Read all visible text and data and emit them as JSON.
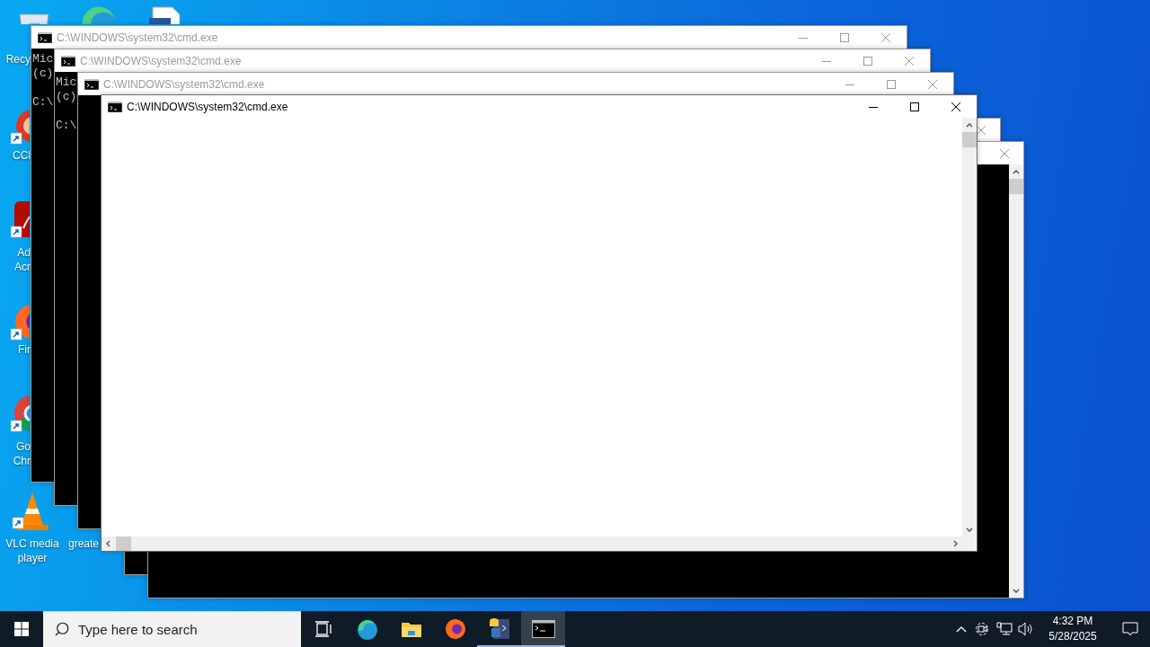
{
  "desktop_icons": [
    {
      "kind": "recycle-bin",
      "label_lines": [
        "Recy"
      ]
    },
    {
      "kind": "edge"
    },
    {
      "kind": "document"
    },
    {
      "kind": "ccleaner",
      "label_lines": [
        "CCl"
      ]
    },
    {
      "kind": "acrobat",
      "label_lines": [
        "Ad",
        "Acr"
      ]
    },
    {
      "kind": "firefox",
      "label_lines": [
        "Fir"
      ]
    },
    {
      "kind": "chrome",
      "label_lines": [
        "Go",
        "Chr"
      ]
    },
    {
      "kind": "vlc",
      "label_lines": [
        "VLC media",
        "player"
      ]
    },
    {
      "kind": "hidden",
      "label_lines": [
        "greate"
      ]
    }
  ],
  "windows": [
    {
      "title": "C:\\WINDOWS\\system32\\cmd.exe",
      "active": false,
      "kind": "console",
      "console_blocks": [
        [
          "Mic",
          "(c)"
        ],
        [
          "C:\\"
        ]
      ],
      "controls": [
        {
          "kind": "minimize"
        },
        {
          "kind": "maximize"
        },
        {
          "kind": "close"
        }
      ]
    },
    {
      "title": "C:\\WINDOWS\\system32\\cmd.exe",
      "active": false,
      "kind": "console",
      "console_blocks": [
        [
          "Mic",
          "(c)"
        ],
        [
          "C:\\"
        ]
      ],
      "controls": [
        {
          "kind": "minimize"
        },
        {
          "kind": "maximize"
        },
        {
          "kind": "close"
        }
      ]
    },
    {
      "title": "C:\\WINDOWS\\system32\\cmd.exe",
      "active": false,
      "kind": "console",
      "controls": [
        {
          "kind": "minimize"
        },
        {
          "kind": "maximize"
        },
        {
          "kind": "close"
        }
      ]
    },
    {
      "title": "C:\\WINDOWS\\system32\\cmd.exe",
      "active": true,
      "kind": "blank",
      "controls": [
        {
          "kind": "minimize"
        },
        {
          "kind": "maximize"
        },
        {
          "kind": "close"
        }
      ],
      "vertical_scrollbar": true,
      "horizontal_scrollbar": true
    },
    {
      "active": false,
      "kind": "console",
      "controls": [
        {
          "kind": "close"
        }
      ]
    },
    {
      "active": false,
      "kind": "console",
      "controls": [
        {
          "kind": "close"
        }
      ],
      "vertical_scrollbar": true
    }
  ],
  "taskbar": {
    "search": {
      "placeholder": "Type here to search"
    },
    "apps": [
      {
        "kind": "task-view",
        "running": false,
        "selected": false
      },
      {
        "kind": "edge",
        "running": false,
        "selected": false
      },
      {
        "kind": "file-explorer",
        "running": false,
        "selected": false
      },
      {
        "kind": "firefox",
        "running": false,
        "selected": false
      },
      {
        "kind": "python",
        "running": true,
        "selected": false
      },
      {
        "kind": "terminal",
        "running": true,
        "selected": true
      }
    ],
    "tray_icons": [
      {
        "kind": "chevron"
      },
      {
        "kind": "meet"
      },
      {
        "kind": "network"
      },
      {
        "kind": "volume"
      }
    ],
    "clock": {
      "time": "4:32 PM",
      "date": "5/28/2025"
    }
  }
}
